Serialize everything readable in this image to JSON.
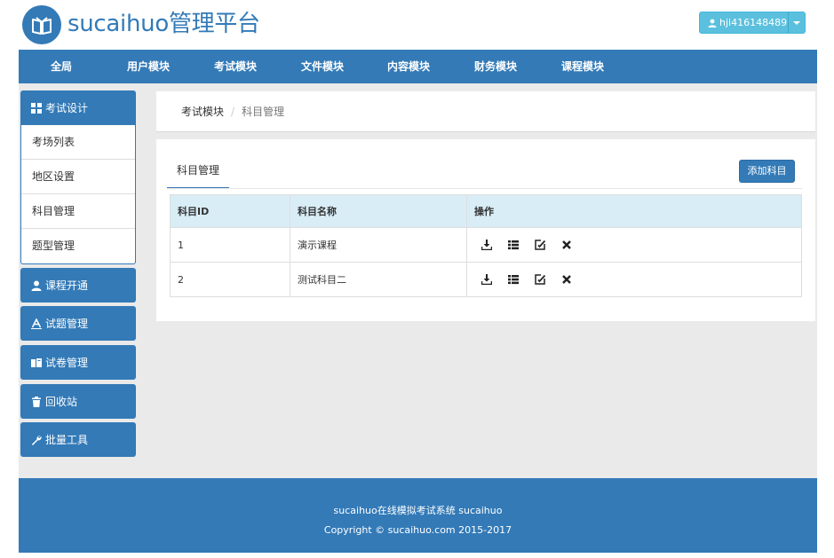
{
  "header": {
    "brand": "sucaihuo管理平台",
    "logo_icon": "book-icon",
    "user": {
      "name": "hjl416148489",
      "icon": "user-icon"
    }
  },
  "nav": {
    "items": [
      {
        "label": "全局"
      },
      {
        "label": "用户模块"
      },
      {
        "label": "考试模块"
      },
      {
        "label": "文件模块"
      },
      {
        "label": "内容模块"
      },
      {
        "label": "财务模块"
      },
      {
        "label": "课程模块"
      }
    ]
  },
  "sidebar": {
    "design": {
      "label": "考试设计",
      "icon": "grid-icon"
    },
    "design_links": [
      {
        "label": "考场列表"
      },
      {
        "label": "地区设置"
      },
      {
        "label": "科目管理"
      },
      {
        "label": "题型管理"
      }
    ],
    "course": {
      "label": "课程开通",
      "icon": "user-icon"
    },
    "questions": {
      "label": "试题管理",
      "icon": "text-icon"
    },
    "papers": {
      "label": "试卷管理",
      "icon": "book-open-icon"
    },
    "trash": {
      "label": "回收站",
      "icon": "trash-icon"
    },
    "tools": {
      "label": "批量工具",
      "icon": "wrench-icon"
    }
  },
  "breadcrumb": {
    "parent": "考试模块",
    "separator": "/",
    "current": "科目管理"
  },
  "panel": {
    "tab": "科目管理",
    "add_button": "添加科目",
    "columns": {
      "id": "科目ID",
      "name": "科目名称",
      "ops": "操作"
    },
    "rows": [
      {
        "id": "1",
        "name": "演示课程"
      },
      {
        "id": "2",
        "name": "测试科目二"
      }
    ],
    "op_icons": [
      "download-icon",
      "list-icon",
      "edit-icon",
      "delete-icon"
    ]
  },
  "footer": {
    "line1": "sucaihuo在线模拟考试系统 sucaihuo",
    "line2": "Copyright © sucaihuo.com 2015-2017"
  },
  "colors": {
    "primary": "#337ab7",
    "info": "#5bc0de",
    "table_head": "#d9edf7",
    "content_bg": "#eaeaea"
  }
}
